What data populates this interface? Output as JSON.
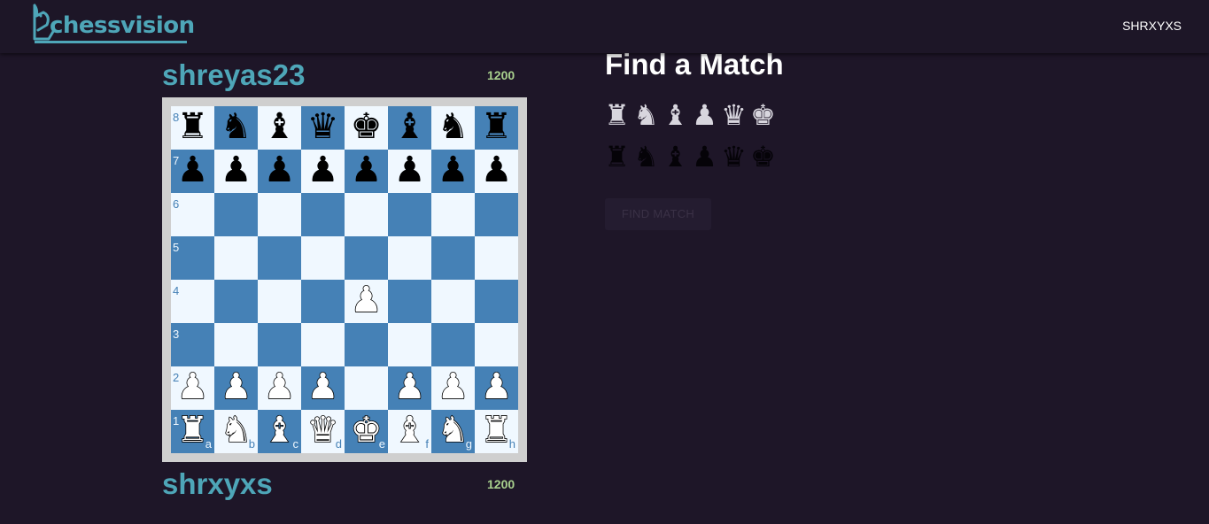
{
  "navbar": {
    "logo_text": "chessvision",
    "username": "SHRXYXS"
  },
  "colors": {
    "background": "#1e1628",
    "accent": "#4ea6b8",
    "rating": "#a9d18e",
    "light_square": "#f0f8ff",
    "dark_square": "#4581b6"
  },
  "opponent": {
    "name": "shreyas23",
    "rating": "1200"
  },
  "player": {
    "name": "shrxyxs",
    "rating": "1200"
  },
  "board": {
    "rank_labels": [
      "8",
      "7",
      "6",
      "5",
      "4",
      "3",
      "2",
      "1"
    ],
    "file_labels": [
      "a",
      "b",
      "c",
      "d",
      "e",
      "f",
      "g",
      "h"
    ],
    "position": [
      [
        "r",
        "n",
        "b",
        "q",
        "k",
        "b",
        "n",
        "r"
      ],
      [
        "p",
        "p",
        "p",
        "p",
        "p",
        "p",
        "p",
        "p"
      ],
      [
        "",
        "",
        "",
        "",
        "",
        "",
        "",
        ""
      ],
      [
        "",
        "",
        "",
        "",
        "",
        "",
        "",
        ""
      ],
      [
        "",
        "",
        "",
        "",
        "P",
        "",
        "",
        ""
      ],
      [
        "",
        "",
        "",
        "",
        "",
        "",
        "",
        ""
      ],
      [
        "P",
        "P",
        "P",
        "P",
        "",
        "P",
        "P",
        "P"
      ],
      [
        "R",
        "N",
        "B",
        "Q",
        "K",
        "B",
        "N",
        "R"
      ]
    ]
  },
  "match": {
    "title": "Find a Match",
    "white_pieces": [
      {
        "name": "rook-icon",
        "glyph": "♜"
      },
      {
        "name": "knight-icon",
        "glyph": "♞"
      },
      {
        "name": "bishop-icon",
        "glyph": "♝"
      },
      {
        "name": "pawn-icon",
        "glyph": "♟"
      },
      {
        "name": "queen-icon",
        "glyph": "♛"
      },
      {
        "name": "king-icon",
        "glyph": "♚"
      }
    ],
    "black_pieces": [
      {
        "name": "rook-icon",
        "glyph": "♜"
      },
      {
        "name": "knight-icon",
        "glyph": "♞"
      },
      {
        "name": "bishop-icon",
        "glyph": "♝"
      },
      {
        "name": "pawn-icon",
        "glyph": "♟"
      },
      {
        "name": "queen-icon",
        "glyph": "♛"
      },
      {
        "name": "king-icon",
        "glyph": "♚"
      }
    ],
    "button_label": "FIND MATCH"
  }
}
